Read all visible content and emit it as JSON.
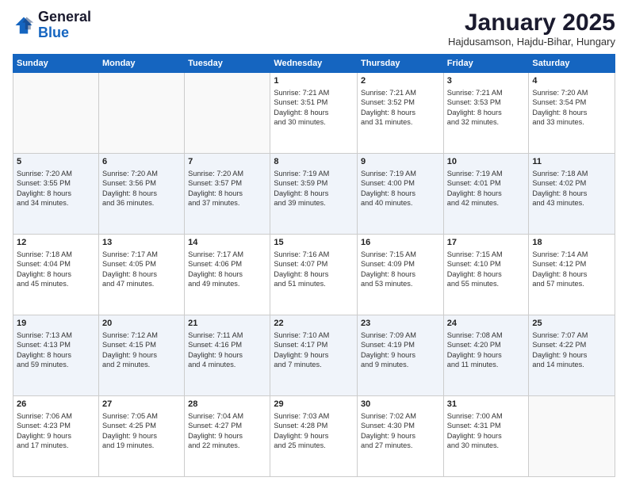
{
  "header": {
    "logo_general": "General",
    "logo_blue": "Blue",
    "month_title": "January 2025",
    "subtitle": "Hajdusamson, Hajdu-Bihar, Hungary"
  },
  "days_of_week": [
    "Sunday",
    "Monday",
    "Tuesday",
    "Wednesday",
    "Thursday",
    "Friday",
    "Saturday"
  ],
  "weeks": [
    [
      {
        "day": "",
        "info": ""
      },
      {
        "day": "",
        "info": ""
      },
      {
        "day": "",
        "info": ""
      },
      {
        "day": "1",
        "info": "Sunrise: 7:21 AM\nSunset: 3:51 PM\nDaylight: 8 hours\nand 30 minutes."
      },
      {
        "day": "2",
        "info": "Sunrise: 7:21 AM\nSunset: 3:52 PM\nDaylight: 8 hours\nand 31 minutes."
      },
      {
        "day": "3",
        "info": "Sunrise: 7:21 AM\nSunset: 3:53 PM\nDaylight: 8 hours\nand 32 minutes."
      },
      {
        "day": "4",
        "info": "Sunrise: 7:20 AM\nSunset: 3:54 PM\nDaylight: 8 hours\nand 33 minutes."
      }
    ],
    [
      {
        "day": "5",
        "info": "Sunrise: 7:20 AM\nSunset: 3:55 PM\nDaylight: 8 hours\nand 34 minutes."
      },
      {
        "day": "6",
        "info": "Sunrise: 7:20 AM\nSunset: 3:56 PM\nDaylight: 8 hours\nand 36 minutes."
      },
      {
        "day": "7",
        "info": "Sunrise: 7:20 AM\nSunset: 3:57 PM\nDaylight: 8 hours\nand 37 minutes."
      },
      {
        "day": "8",
        "info": "Sunrise: 7:19 AM\nSunset: 3:59 PM\nDaylight: 8 hours\nand 39 minutes."
      },
      {
        "day": "9",
        "info": "Sunrise: 7:19 AM\nSunset: 4:00 PM\nDaylight: 8 hours\nand 40 minutes."
      },
      {
        "day": "10",
        "info": "Sunrise: 7:19 AM\nSunset: 4:01 PM\nDaylight: 8 hours\nand 42 minutes."
      },
      {
        "day": "11",
        "info": "Sunrise: 7:18 AM\nSunset: 4:02 PM\nDaylight: 8 hours\nand 43 minutes."
      }
    ],
    [
      {
        "day": "12",
        "info": "Sunrise: 7:18 AM\nSunset: 4:04 PM\nDaylight: 8 hours\nand 45 minutes."
      },
      {
        "day": "13",
        "info": "Sunrise: 7:17 AM\nSunset: 4:05 PM\nDaylight: 8 hours\nand 47 minutes."
      },
      {
        "day": "14",
        "info": "Sunrise: 7:17 AM\nSunset: 4:06 PM\nDaylight: 8 hours\nand 49 minutes."
      },
      {
        "day": "15",
        "info": "Sunrise: 7:16 AM\nSunset: 4:07 PM\nDaylight: 8 hours\nand 51 minutes."
      },
      {
        "day": "16",
        "info": "Sunrise: 7:15 AM\nSunset: 4:09 PM\nDaylight: 8 hours\nand 53 minutes."
      },
      {
        "day": "17",
        "info": "Sunrise: 7:15 AM\nSunset: 4:10 PM\nDaylight: 8 hours\nand 55 minutes."
      },
      {
        "day": "18",
        "info": "Sunrise: 7:14 AM\nSunset: 4:12 PM\nDaylight: 8 hours\nand 57 minutes."
      }
    ],
    [
      {
        "day": "19",
        "info": "Sunrise: 7:13 AM\nSunset: 4:13 PM\nDaylight: 8 hours\nand 59 minutes."
      },
      {
        "day": "20",
        "info": "Sunrise: 7:12 AM\nSunset: 4:15 PM\nDaylight: 9 hours\nand 2 minutes."
      },
      {
        "day": "21",
        "info": "Sunrise: 7:11 AM\nSunset: 4:16 PM\nDaylight: 9 hours\nand 4 minutes."
      },
      {
        "day": "22",
        "info": "Sunrise: 7:10 AM\nSunset: 4:17 PM\nDaylight: 9 hours\nand 7 minutes."
      },
      {
        "day": "23",
        "info": "Sunrise: 7:09 AM\nSunset: 4:19 PM\nDaylight: 9 hours\nand 9 minutes."
      },
      {
        "day": "24",
        "info": "Sunrise: 7:08 AM\nSunset: 4:20 PM\nDaylight: 9 hours\nand 11 minutes."
      },
      {
        "day": "25",
        "info": "Sunrise: 7:07 AM\nSunset: 4:22 PM\nDaylight: 9 hours\nand 14 minutes."
      }
    ],
    [
      {
        "day": "26",
        "info": "Sunrise: 7:06 AM\nSunset: 4:23 PM\nDaylight: 9 hours\nand 17 minutes."
      },
      {
        "day": "27",
        "info": "Sunrise: 7:05 AM\nSunset: 4:25 PM\nDaylight: 9 hours\nand 19 minutes."
      },
      {
        "day": "28",
        "info": "Sunrise: 7:04 AM\nSunset: 4:27 PM\nDaylight: 9 hours\nand 22 minutes."
      },
      {
        "day": "29",
        "info": "Sunrise: 7:03 AM\nSunset: 4:28 PM\nDaylight: 9 hours\nand 25 minutes."
      },
      {
        "day": "30",
        "info": "Sunrise: 7:02 AM\nSunset: 4:30 PM\nDaylight: 9 hours\nand 27 minutes."
      },
      {
        "day": "31",
        "info": "Sunrise: 7:00 AM\nSunset: 4:31 PM\nDaylight: 9 hours\nand 30 minutes."
      },
      {
        "day": "",
        "info": ""
      }
    ]
  ]
}
